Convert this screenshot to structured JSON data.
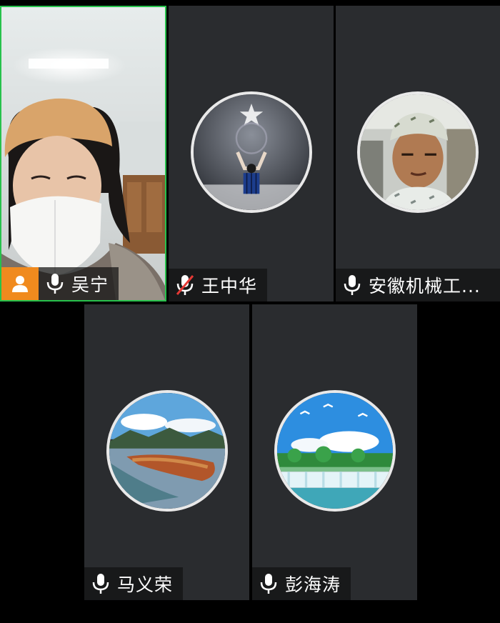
{
  "participants": [
    {
      "name": "吴宁",
      "host": true,
      "mic": "on",
      "video": true
    },
    {
      "name": "王中华",
      "host": false,
      "mic": "muted",
      "video": false,
      "avatar": "soccer-player-avatar"
    },
    {
      "name": "安徽机械工...",
      "host": false,
      "mic": "on",
      "video": false,
      "avatar": "man-in-car-avatar"
    },
    {
      "name": "马义荣",
      "host": false,
      "mic": "on",
      "video": false,
      "avatar": "lake-landscape-avatar"
    },
    {
      "name": "彭海涛",
      "host": false,
      "mic": "on",
      "video": false,
      "avatar": "waterfall-landscape-avatar"
    }
  ],
  "colors": {
    "background": "#000000",
    "tile": "#2a2c2f",
    "active_border": "#27c24c",
    "host_badge": "#f08a1e",
    "muted": "#e53935"
  }
}
